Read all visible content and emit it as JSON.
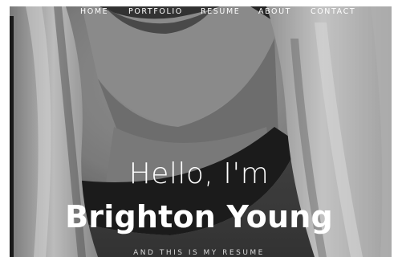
{
  "nav": {
    "items": [
      {
        "label": "HOME"
      },
      {
        "label": "PORTFOLIO"
      },
      {
        "label": "RESUME"
      },
      {
        "label": "ABOUT"
      },
      {
        "label": "CONTACT"
      }
    ]
  },
  "hero": {
    "greeting": "Hello, I'm",
    "name": "Brighton Young",
    "tagline": "AND THIS IS MY RESUME"
  },
  "colors": {
    "text": "#ffffff",
    "background": "#6e6e6e"
  }
}
